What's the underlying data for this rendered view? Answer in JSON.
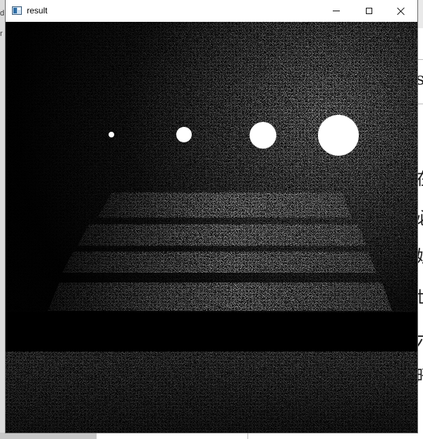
{
  "window": {
    "title": "result",
    "controls": {
      "minimize": "minimize-icon",
      "maximize": "maximize-icon",
      "close": "close-icon"
    }
  },
  "background_app": {
    "left_glyphs": [
      "d",
      "r"
    ],
    "right_glyphs": [
      "s",
      "在",
      "必",
      "妨",
      "世",
      "六",
      "晤"
    ]
  },
  "render": {
    "description_icon": "render-image",
    "light_colors": {
      "spot": "#ffffff",
      "floor": "#1a1a1a"
    }
  }
}
